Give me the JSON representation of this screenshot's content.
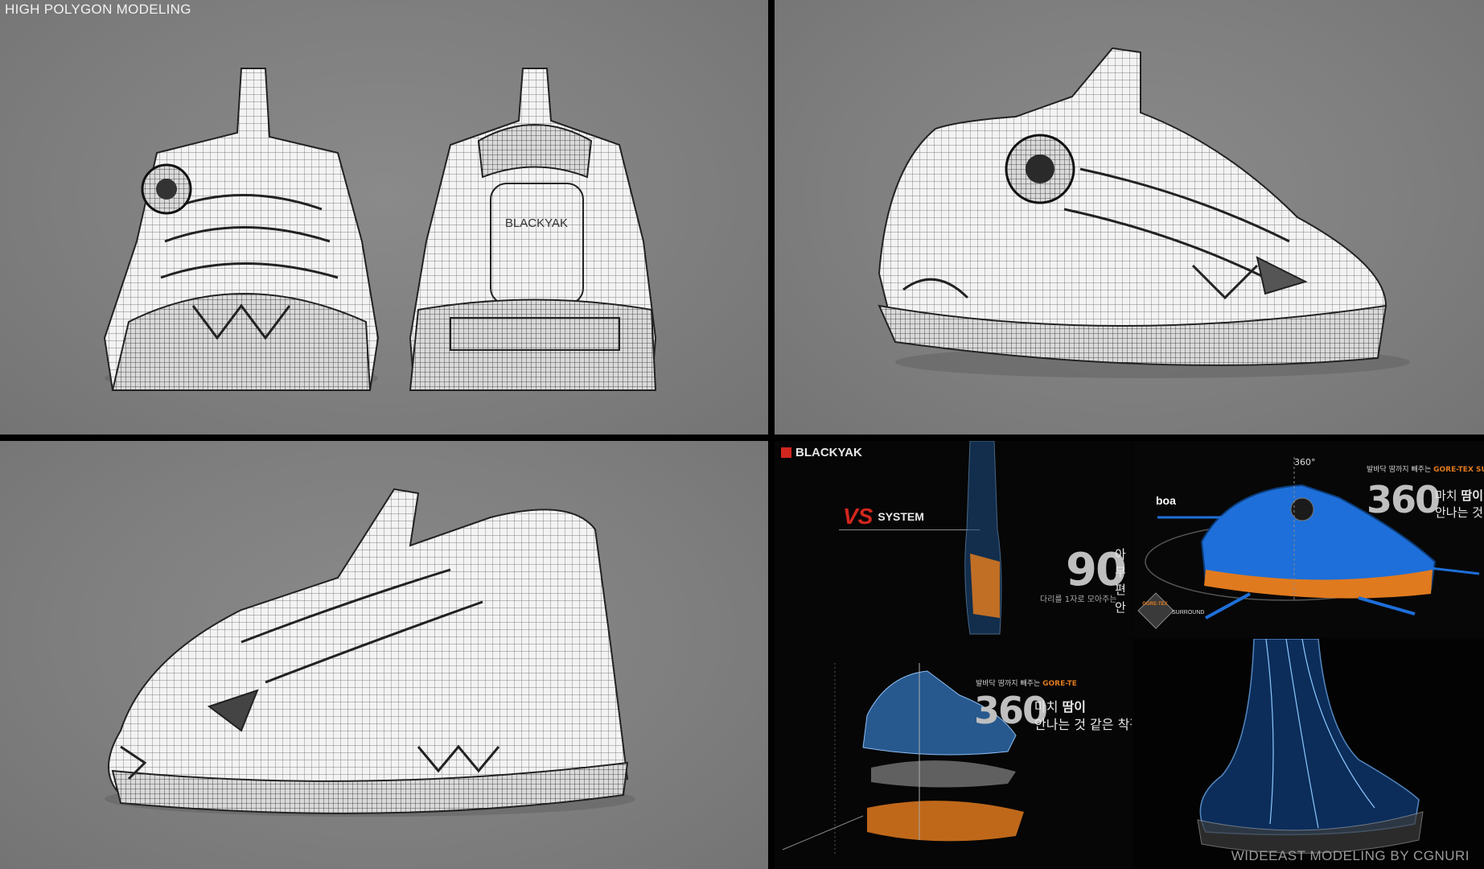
{
  "header": {
    "title": "HIGH POLYGON MODELING"
  },
  "footer": {
    "credit": "WIDEEAST MODELING BY CGNURI"
  },
  "views": {
    "front_logo": "BLACKYAK"
  },
  "promo": {
    "brand": "BLACKYAK",
    "system_mark": "VS",
    "system_label": "SYSTEM",
    "deg90": "90",
    "deg90_line1": "아무",
    "deg90_line2": "편안",
    "deg90_caption": "다리를 1자로 모아주는",
    "deg360_top": "360°",
    "boa_label": "boa",
    "goretex_caption_a": "발바닥 땀까지 빼주는",
    "goretex_a": "GORE-TEX SURR",
    "deg360": "360",
    "deg360_line1a": "마치",
    "deg360_line1b": "땀이",
    "deg360_line2": "안나는 것 같",
    "goretex_badge": "GORE-TEX",
    "surround_label": "SURROUND",
    "goretex_caption_b": "발바닥 땀까지 빼주는",
    "goretex_b": "GORE-TE",
    "deg360_b": "360",
    "deg360b_line1a": "마치",
    "deg360b_line1b": "땀이",
    "deg360b_line2": "안나는 것 같은 착각"
  },
  "colors": {
    "accent_orange": "#e07a1f",
    "accent_blue": "#1e6fd9",
    "bg_gray": "#808080"
  }
}
